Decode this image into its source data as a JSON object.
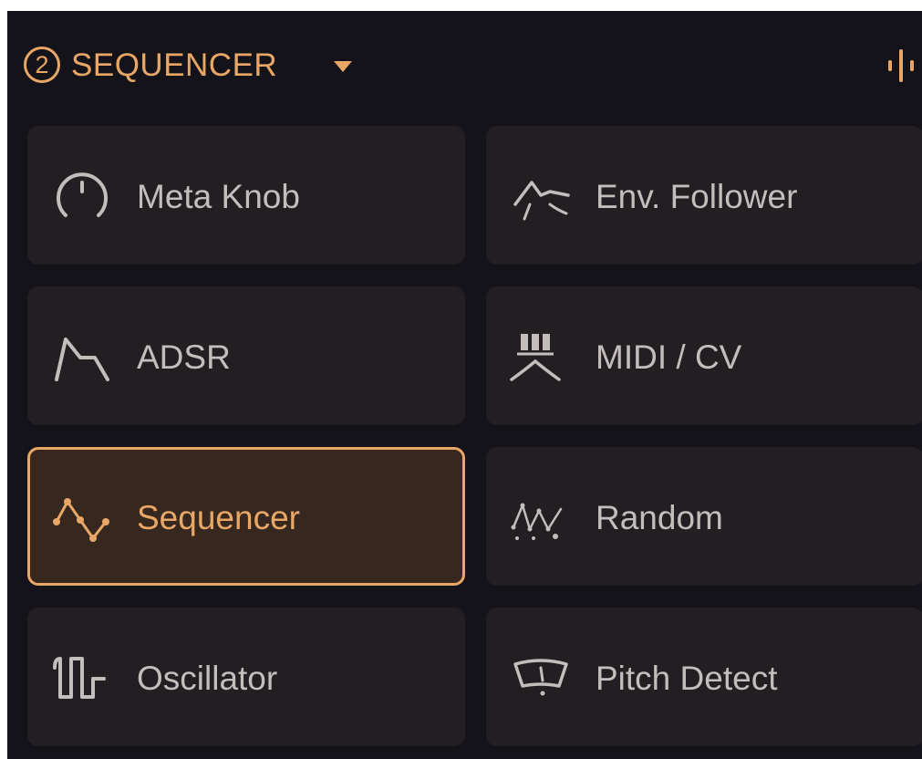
{
  "header": {
    "slot_number": "2",
    "title": "SEQUENCER",
    "icons": {
      "dropdown": "caret-down-icon",
      "meter": "level-meter-icon"
    }
  },
  "modulators": [
    {
      "label": "Meta Knob",
      "icon": "knob-icon",
      "selected": false
    },
    {
      "label": "Env. Follower",
      "icon": "envelope-follower-icon",
      "selected": false
    },
    {
      "label": "ADSR",
      "icon": "adsr-envelope-icon",
      "selected": false
    },
    {
      "label": "MIDI / CV",
      "icon": "midi-cv-icon",
      "selected": false
    },
    {
      "label": "Sequencer",
      "icon": "sequencer-steps-icon",
      "selected": true
    },
    {
      "label": "Random",
      "icon": "random-icon",
      "selected": false
    },
    {
      "label": "Oscillator",
      "icon": "oscillator-wave-icon",
      "selected": false
    },
    {
      "label": "Pitch Detect",
      "icon": "pitch-detect-icon",
      "selected": false
    }
  ],
  "colors": {
    "accent": "#e8a766",
    "panel_background": "#15131a",
    "tile_background": "#221e22",
    "selected_tile_background": "#36281e",
    "label_text": "#c3bdbc"
  }
}
